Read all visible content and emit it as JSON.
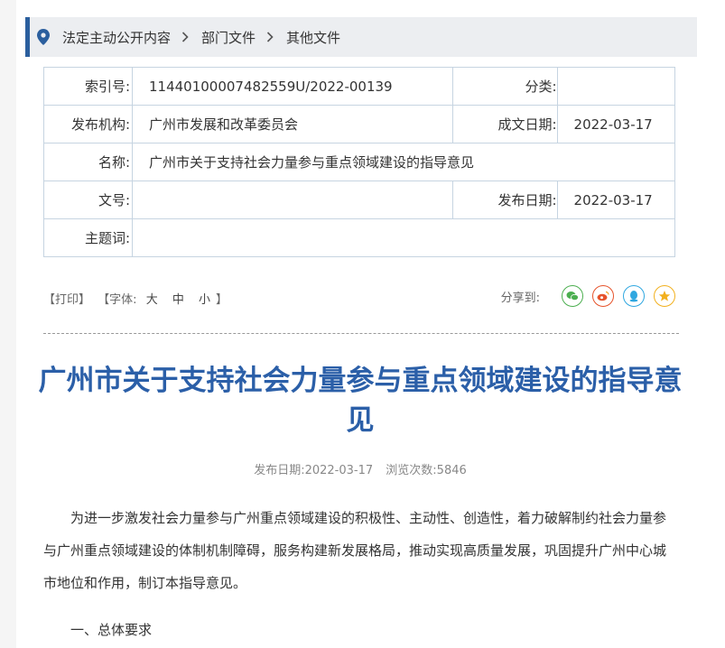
{
  "breadcrumb": {
    "items": [
      "法定主动公开内容",
      "部门文件",
      "其他文件"
    ]
  },
  "meta": {
    "index_label": "索引号:",
    "index_value": "11440100007482559U/2022-00139",
    "category_label": "分类:",
    "category_value": "",
    "publisher_label": "发布机构:",
    "publisher_value": "广州市发展和改革委员会",
    "written_date_label": "成文日期:",
    "written_date_value": "2022-03-17",
    "name_label": "名称:",
    "name_value": "广州市关于支持社会力量参与重点领域建设的指导意见",
    "doc_no_label": "文号:",
    "doc_no_value": "",
    "publish_date_label": "发布日期:",
    "publish_date_value": "2022-03-17",
    "subject_label": "主题词:",
    "subject_value": ""
  },
  "tools": {
    "print": "【打印】",
    "font_open": "【字体:",
    "font_large": "大",
    "font_medium": "中",
    "font_small": "小",
    "font_close": "】",
    "share_label": "分享到:",
    "share_icons": [
      "wechat-icon",
      "weibo-icon",
      "qq-icon",
      "qzone-icon"
    ]
  },
  "article": {
    "title": "广州市关于支持社会力量参与重点领域建设的指导意见",
    "publish_date_text": "发布日期:2022-03-17",
    "views_text": "浏览次数:5846",
    "paragraphs": [
      "为进一步激发社会力量参与广州重点领域建设的积极性、主动性、创造性，着力破解制约社会力量参与广州重点领域建设的体制机制障碍，服务构建新发展格局，推动实现高质量发展，巩固提升广州中心城市地位和作用，制订本指导意见。"
    ],
    "section1": "一、总体要求"
  },
  "colors": {
    "accent": "#2b5f9e",
    "title": "#2b5fa8",
    "table_border": "#c6d4e1",
    "wechat": "#4caf50",
    "weibo": "#e6532b",
    "qq": "#2fa7e0",
    "qzone": "#f2b01e"
  }
}
